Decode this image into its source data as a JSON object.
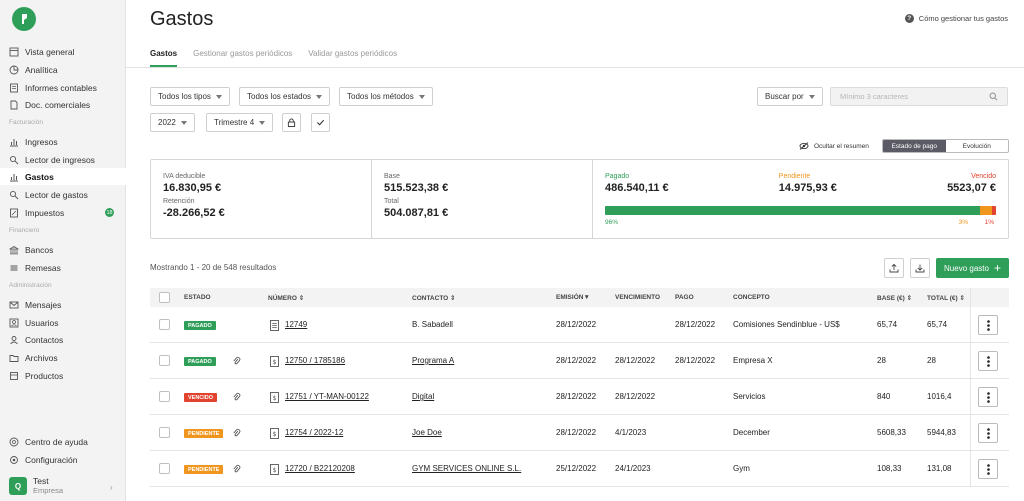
{
  "sidebar": {
    "items_top": [
      {
        "label": "Vista general",
        "icon": "layout-icon"
      },
      {
        "label": "Analítica",
        "icon": "pie-chart-icon"
      },
      {
        "label": "Informes contables",
        "icon": "report-icon"
      },
      {
        "label": "Doc. comerciales",
        "icon": "document-icon"
      }
    ],
    "section_facturacion": "Facturación",
    "items_facturacion": [
      {
        "label": "Ingresos",
        "icon": "bar-chart-icon"
      },
      {
        "label": "Lector de ingresos",
        "icon": "scan-icon"
      },
      {
        "label": "Gastos",
        "icon": "bar-chart-icon",
        "active": true
      },
      {
        "label": "Lector de gastos",
        "icon": "scan-icon"
      },
      {
        "label": "Impuestos",
        "icon": "tax-icon",
        "badge": "18"
      }
    ],
    "section_financiero": "Financiero",
    "items_financiero": [
      {
        "label": "Bancos",
        "icon": "bank-icon"
      },
      {
        "label": "Remesas",
        "icon": "remittance-icon"
      }
    ],
    "section_administracion": "Administración",
    "items_administracion": [
      {
        "label": "Mensajes",
        "icon": "mail-icon"
      },
      {
        "label": "Usuarios",
        "icon": "user-icon"
      },
      {
        "label": "Contactos",
        "icon": "contacts-icon"
      },
      {
        "label": "Archivos",
        "icon": "folder-icon"
      },
      {
        "label": "Productos",
        "icon": "box-icon"
      }
    ],
    "items_bottom": [
      {
        "label": "Centro de ayuda",
        "icon": "help-icon"
      },
      {
        "label": "Configuración",
        "icon": "gear-icon"
      }
    ],
    "user": {
      "initial": "Q",
      "name": "Test",
      "role": "Empresa"
    }
  },
  "header": {
    "title": "Gastos",
    "help_link": "Cómo gestionar tus gastos",
    "tabs": [
      "Gastos",
      "Gestionar gastos periódicos",
      "Validar gastos periódicos"
    ]
  },
  "filters": {
    "types": "Todos los tipos",
    "states": "Todos los estados",
    "methods": "Todos los métodos",
    "year": "2022",
    "quarter": "Trimestre 4",
    "search_by": "Buscar por",
    "search_placeholder": "Mínimo 3 caracteres"
  },
  "summary_controls": {
    "hide_summary": "Ocultar el resumen",
    "segments": [
      "Estado de pago",
      "Evolución"
    ]
  },
  "summary": {
    "iva_label": "IVA deducible",
    "iva_value": "16.830,95 €",
    "retencion_label": "Retención",
    "retencion_value": "-28.266,52 €",
    "base_label": "Base",
    "base_value": "515.523,38 €",
    "total_label": "Total",
    "total_value": "504.087,81 €",
    "pagado_label": "Pagado",
    "pagado_value": "486.540,11 €",
    "pendiente_label": "Pendiente",
    "pendiente_value": "14.975,93 €",
    "vencido_label": "Vencido",
    "vencido_value": "5523,07 €",
    "pagado_pct": "96%",
    "pendiente_pct": "3%",
    "vencido_pct": "1%",
    "fractions": {
      "pagado": 0.96,
      "pendiente": 0.03,
      "vencido": 0.01
    }
  },
  "colors": {
    "accent": "#2f9e59",
    "pagado": "#2f9e59",
    "pendiente": "#f0961e",
    "vencido": "#e2432f"
  },
  "list": {
    "results": "Mostrando 1 - 20 de 548 resultados",
    "new_button": "Nuevo gasto",
    "columns": {
      "estado": "ESTADO",
      "numero": "NÚMERO",
      "contacto": "CONTACTO",
      "emision": "EMISIÓN",
      "vencimiento": "VENCIMIENTO",
      "pago": "PAGO",
      "concepto": "CONCEPTO",
      "base": "BASE (€)",
      "total": "TOTAL (€)"
    },
    "rows": [
      {
        "estado": "PAGADO",
        "numero": "12749",
        "contacto": "B. Sabadell",
        "emision": "28/12/2022",
        "vencimiento": "",
        "pago": "28/12/2022",
        "concepto": "Comisiones Sendinblue - US$",
        "base": "65,74",
        "total": "65,74"
      },
      {
        "estado": "PAGADO",
        "numero": "12750 / 1785186",
        "contacto": "Programa A",
        "emision": "28/12/2022",
        "vencimiento": "28/12/2022",
        "pago": "28/12/2022",
        "concepto": "Empresa X",
        "base": "28",
        "total": "28"
      },
      {
        "estado": "VENCIDO",
        "numero": "12751 / YT-MAN-00122",
        "contacto": "Digital",
        "emision": "28/12/2022",
        "vencimiento": "28/12/2022",
        "pago": "",
        "concepto": "Servicios",
        "base": "840",
        "total": "1016,4"
      },
      {
        "estado": "PENDIENTE",
        "numero": "12754 / 2022-12",
        "contacto": "Joe Doe",
        "emision": "28/12/2022",
        "vencimiento": "4/1/2023",
        "pago": "",
        "concepto": "December",
        "base": "5608,33",
        "total": "5944,83"
      },
      {
        "estado": "PENDIENTE",
        "numero": "12720 / B22120208",
        "contacto": "GYM SERVICES ONLINE S.L.",
        "emision": "25/12/2022",
        "vencimiento": "24/1/2023",
        "pago": "",
        "concepto": "Gym",
        "base": "108,33",
        "total": "131,08"
      }
    ]
  }
}
